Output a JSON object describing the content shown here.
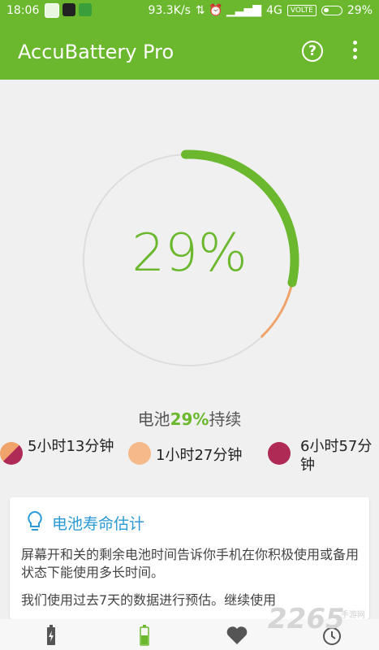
{
  "status_bar": {
    "time": "18:06",
    "net_speed": "93.3K/s",
    "signal": "4G",
    "volte": "VOLTE",
    "battery": "29%"
  },
  "app_bar": {
    "title": "AccuBattery Pro",
    "help_label": "?"
  },
  "gauge": {
    "percent_text": "29%",
    "level_fraction": 0.29,
    "colors": {
      "main": "#6bb82e",
      "secondary": "#f0a36a",
      "track": "#dddddd"
    }
  },
  "duration": {
    "prefix": "电池",
    "value": "29%",
    "suffix": "持续"
  },
  "stats": [
    {
      "icon": "screen-on-icon",
      "label": "5小时13分钟"
    },
    {
      "icon": "screen-off-icon",
      "label": "1小时27分钟"
    },
    {
      "icon": "sleep-icon",
      "label": "6小时57分钟"
    }
  ],
  "card": {
    "title": "电池寿命估计",
    "p1": "屏幕开和关的剩余电池时间告诉你手机在你积极使用或备用状态下能使用多长时间。",
    "p2": "我们使用过去7天的数据进行预估。继续使用"
  },
  "bottom_nav": [
    {
      "icon": "battery-charge-icon"
    },
    {
      "icon": "battery-icon"
    },
    {
      "icon": "heart-icon"
    },
    {
      "icon": "history-icon"
    }
  ],
  "watermark": {
    "main": "2265",
    "sub": "手游网"
  }
}
